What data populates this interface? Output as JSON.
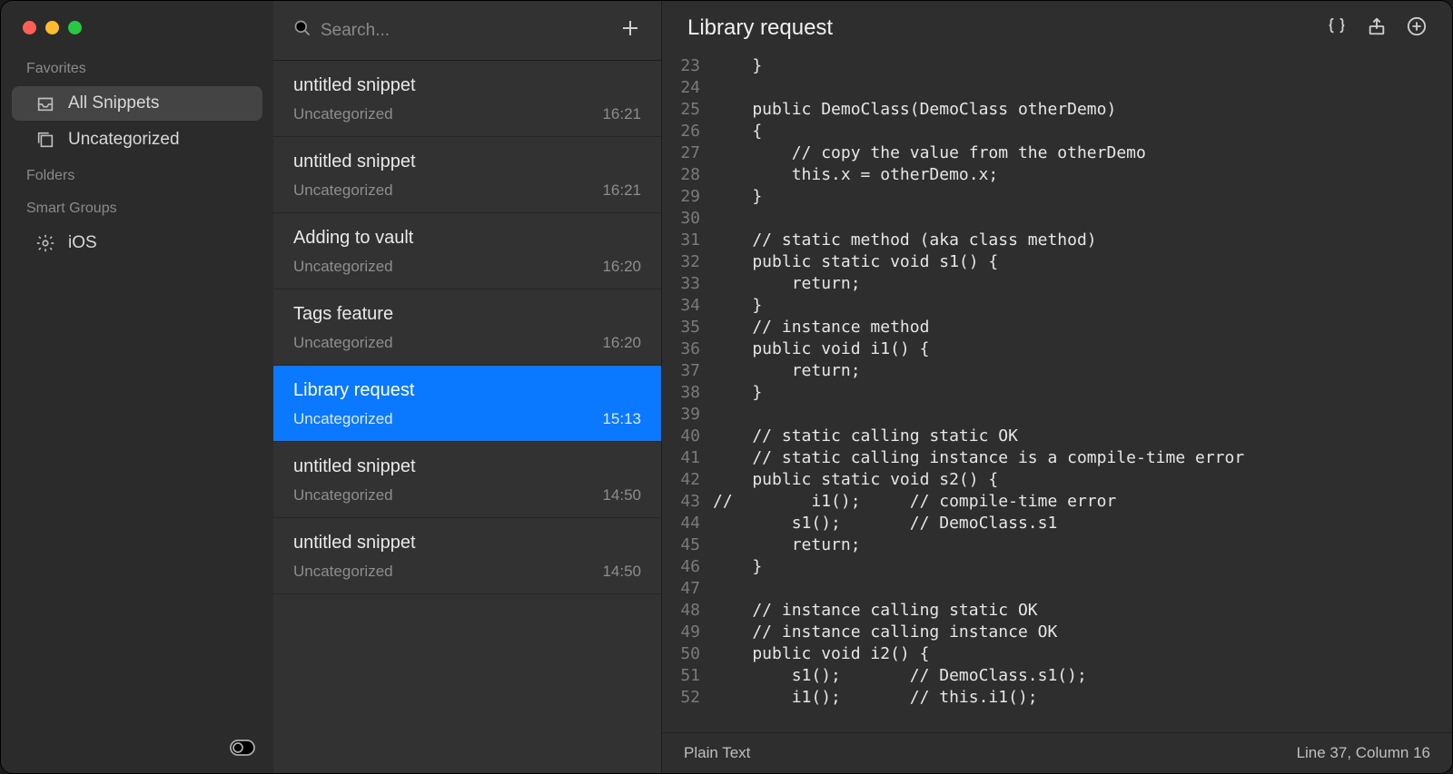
{
  "sidebar": {
    "sections": [
      {
        "title": "Favorites",
        "items": [
          {
            "label": "All Snippets",
            "icon": "tray",
            "active": true
          },
          {
            "label": "Uncategorized",
            "icon": "square-stack",
            "active": false
          }
        ]
      },
      {
        "title": "Folders",
        "items": []
      },
      {
        "title": "Smart Groups",
        "items": [
          {
            "label": "iOS",
            "icon": "gear",
            "active": false
          }
        ]
      }
    ]
  },
  "search": {
    "placeholder": "Search..."
  },
  "snippets": [
    {
      "title": "untitled snippet",
      "category": "Uncategorized",
      "time": "16:21",
      "selected": false
    },
    {
      "title": "untitled snippet",
      "category": "Uncategorized",
      "time": "16:21",
      "selected": false
    },
    {
      "title": "Adding to vault",
      "category": "Uncategorized",
      "time": "16:20",
      "selected": false
    },
    {
      "title": "Tags feature",
      "category": "Uncategorized",
      "time": "16:20",
      "selected": false
    },
    {
      "title": "Library request",
      "category": "Uncategorized",
      "time": "15:13",
      "selected": true
    },
    {
      "title": "untitled snippet",
      "category": "Uncategorized",
      "time": "14:50",
      "selected": false
    },
    {
      "title": "untitled snippet",
      "category": "Uncategorized",
      "time": "14:50",
      "selected": false
    }
  ],
  "editor": {
    "title": "Library request",
    "language": "Plain Text",
    "cursor": "Line 37, Column 16",
    "code": [
      {
        "n": 23,
        "t": "    }"
      },
      {
        "n": 24,
        "t": ""
      },
      {
        "n": 25,
        "t": "    public DemoClass(DemoClass otherDemo)"
      },
      {
        "n": 26,
        "t": "    {"
      },
      {
        "n": 27,
        "t": "        // copy the value from the otherDemo"
      },
      {
        "n": 28,
        "t": "        this.x = otherDemo.x;"
      },
      {
        "n": 29,
        "t": "    }"
      },
      {
        "n": 30,
        "t": ""
      },
      {
        "n": 31,
        "t": "    // static method (aka class method)"
      },
      {
        "n": 32,
        "t": "    public static void s1() {"
      },
      {
        "n": 33,
        "t": "        return;"
      },
      {
        "n": 34,
        "t": "    }"
      },
      {
        "n": 35,
        "t": "    // instance method"
      },
      {
        "n": 36,
        "t": "    public void i1() {"
      },
      {
        "n": 37,
        "t": "        return;"
      },
      {
        "n": 38,
        "t": "    }"
      },
      {
        "n": 39,
        "t": ""
      },
      {
        "n": 40,
        "t": "    // static calling static OK"
      },
      {
        "n": 41,
        "t": "    // static calling instance is a compile-time error"
      },
      {
        "n": 42,
        "t": "    public static void s2() {"
      },
      {
        "n": 43,
        "t": "//        i1();     // compile-time error"
      },
      {
        "n": 44,
        "t": "        s1();       // DemoClass.s1"
      },
      {
        "n": 45,
        "t": "        return;"
      },
      {
        "n": 46,
        "t": "    }"
      },
      {
        "n": 47,
        "t": ""
      },
      {
        "n": 48,
        "t": "    // instance calling static OK"
      },
      {
        "n": 49,
        "t": "    // instance calling instance OK"
      },
      {
        "n": 50,
        "t": "    public void i2() {"
      },
      {
        "n": 51,
        "t": "        s1();       // DemoClass.s1();"
      },
      {
        "n": 52,
        "t": "        i1();       // this.i1();"
      }
    ]
  }
}
